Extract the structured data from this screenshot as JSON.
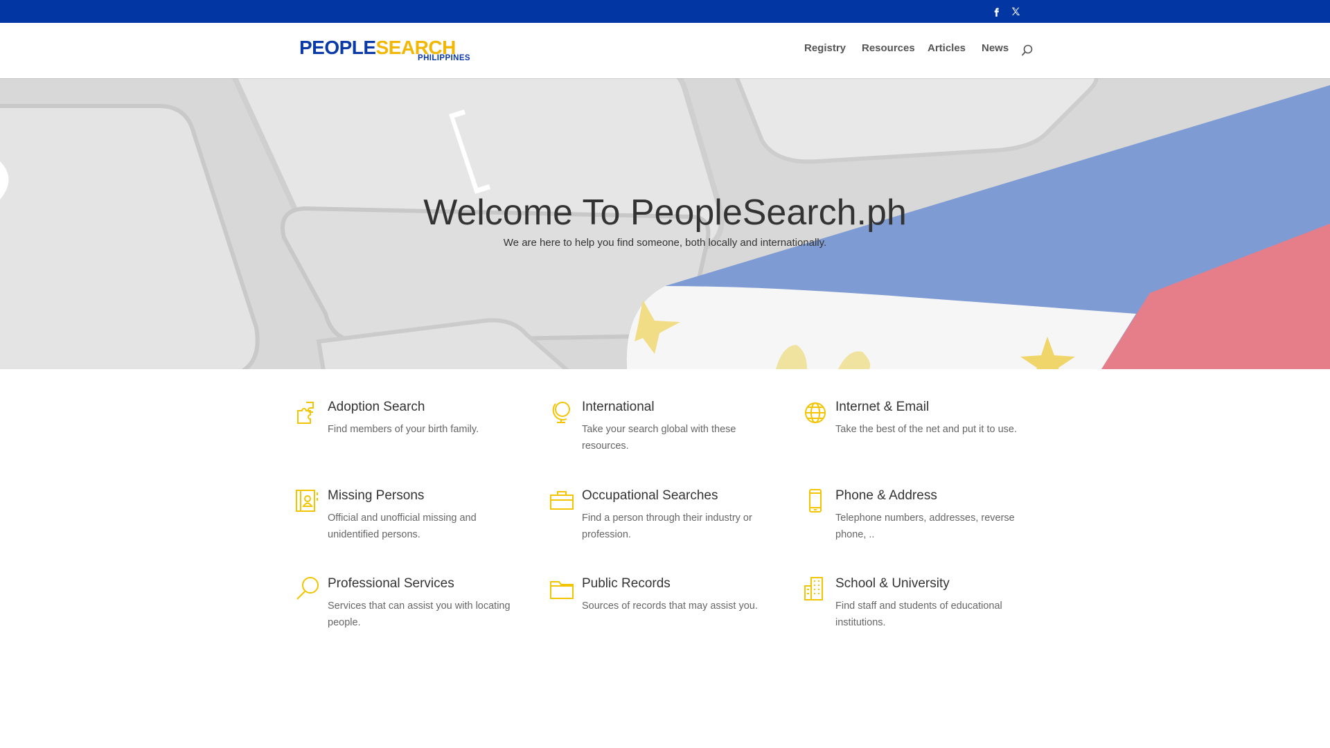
{
  "social": {
    "facebook_icon": "facebook-icon",
    "twitter_icon": "x-twitter-icon"
  },
  "header": {
    "logo_line1_a": "PEOPLE",
    "logo_line1_b": "SEARCH",
    "logo_line2": "PHILIPPINES",
    "nav": [
      "Registry",
      "Resources",
      "Articles",
      "News"
    ],
    "search_icon": "search-icon"
  },
  "hero": {
    "title": "Welcome To PeopleSearch.ph",
    "subtitle": "We are here to help you find someone, both locally and internationally."
  },
  "features": [
    {
      "title": "Adoption Search",
      "desc": "Find members of your birth family.",
      "icon": "puzzle-icon"
    },
    {
      "title": "International",
      "desc": "Take your search global with these resources.",
      "icon": "globe-stand-icon"
    },
    {
      "title": "Internet & Email",
      "desc": "Take the best of the net and put it to use.",
      "icon": "globe-icon"
    },
    {
      "title": "Missing Persons",
      "desc": "Official and unofficial missing and unidentified persons.",
      "icon": "contact-book-icon"
    },
    {
      "title": "Occupational Searches",
      "desc": "Find a person through their industry or profession.",
      "icon": "briefcase-icon"
    },
    {
      "title": "Phone & Address",
      "desc": "Telephone numbers, addresses, reverse phone, ..",
      "icon": "mobile-phone-icon"
    },
    {
      "title": "Professional Services",
      "desc": "Services that can assist you with locating people.",
      "icon": "magnifier-icon"
    },
    {
      "title": "Public Records",
      "desc": "Sources of records that may assist you.",
      "icon": "folder-icon"
    },
    {
      "title": "School & University",
      "desc": "Find staff and students of educational institutions.",
      "icon": "building-icon"
    }
  ],
  "colors": {
    "topbar": "#0237a3",
    "accent_yellow": "#f2c500",
    "flag_blue": "#7f9bd4",
    "flag_red": "#e77f8a"
  }
}
